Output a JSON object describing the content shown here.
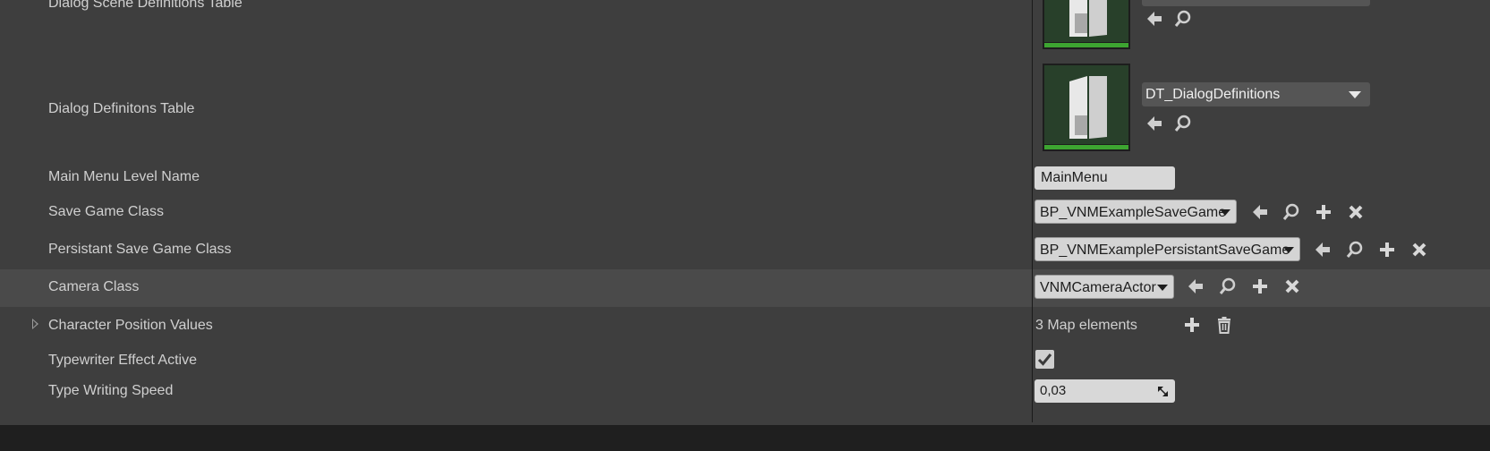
{
  "properties": {
    "dialog_scene_definitions_table": {
      "label": "Dialog Scene Definitions Table"
    },
    "dialog_definitions_table": {
      "label": "Dialog Definitons Table",
      "value": "DT_DialogDefinitions"
    },
    "main_menu_level_name": {
      "label": "Main Menu Level Name",
      "value": "MainMenu"
    },
    "save_game_class": {
      "label": "Save Game Class",
      "value": "BP_VNMExampleSaveGame"
    },
    "persistant_save_game_class": {
      "label": "Persistant Save Game Class",
      "value": "BP_VNMExamplePersistantSaveGame"
    },
    "camera_class": {
      "label": "Camera Class",
      "value": "VNMCameraActor"
    },
    "character_position_values": {
      "label": "Character Position Values",
      "value": "3 Map elements"
    },
    "typewriter_effect_active": {
      "label": "Typewriter Effect Active",
      "checked": true
    },
    "type_writing_speed": {
      "label": "Type Writing Speed",
      "value": "0,03"
    }
  },
  "icons": {
    "use": "arrow-left-icon",
    "browse": "magnifier-icon",
    "add": "plus-icon",
    "clear": "x-icon",
    "delete": "trash-icon",
    "asset": "datatable-thumbnail-icon"
  },
  "colors": {
    "panel_bg": "#3e3e3e",
    "row_highlight": "#4a4a4a",
    "thumb_bg": "#28402a",
    "thumb_bar": "#3da531"
  }
}
